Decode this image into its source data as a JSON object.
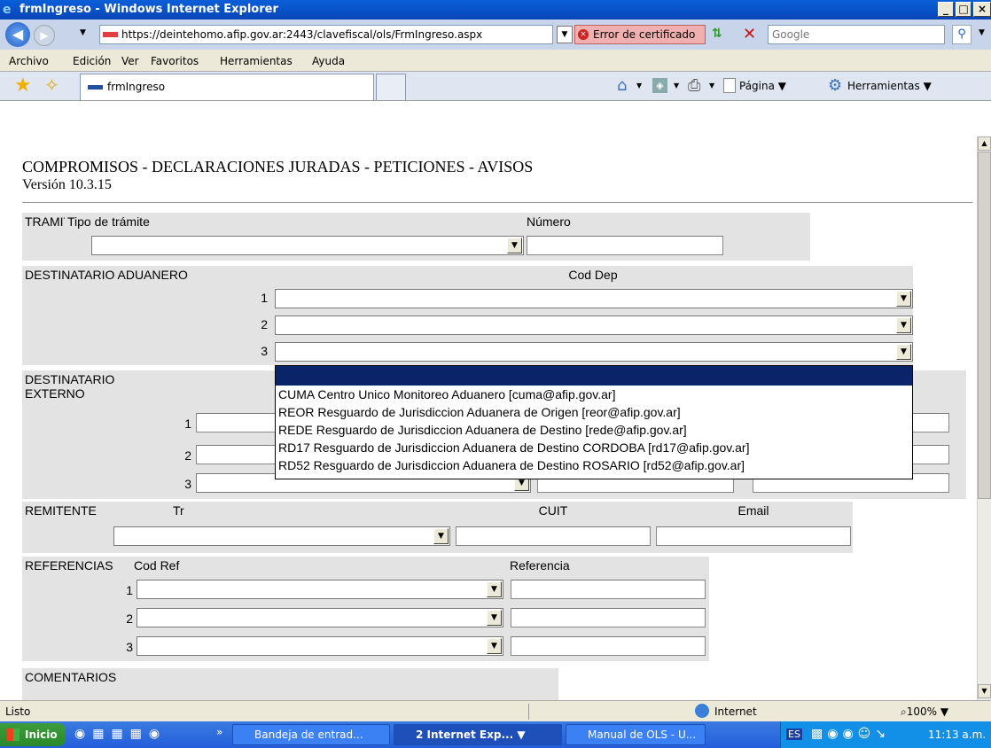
{
  "window": {
    "title": "frmIngreso - Windows Internet Explorer",
    "min": "_",
    "max": "□",
    "close": "×"
  },
  "address": {
    "url": "https://deintehomo.afip.gov.ar:2443/clavefiscal/ols/FrmIngreso.aspx",
    "cert_error": "Error de certificado",
    "search_placeholder": "Google"
  },
  "menu": [
    "Archivo",
    "Edición",
    "Ver",
    "Favoritos",
    "Herramientas",
    "Ayuda"
  ],
  "tab": {
    "label": "frmIngreso"
  },
  "cmdbar": {
    "pagina": "Página",
    "herramientas": "Herramientas"
  },
  "page": {
    "title": "COMPROMISOS - DECLARACIONES JURADAS - PETICIONES - AVISOS",
    "version": "Versión 10.3.15"
  },
  "tramite": {
    "label": "TRAMITE",
    "tipo": "Tipo de trámite",
    "numero": "Número"
  },
  "dest_aduanero": {
    "label": "DESTINATARIO ADUANERO",
    "col": "Cod Dep",
    "rows": [
      "1",
      "2",
      "3"
    ]
  },
  "dest_externo": {
    "label1": "DESTINATARIO",
    "label2": "EXTERNO",
    "rows": [
      "1",
      "2",
      "3"
    ]
  },
  "dropdown": {
    "options": [
      "",
      "CUMA Centro Unico Monitoreo Aduanero [cuma@afip.gov.ar]",
      "REOR Resguardo de Jurisdiccion Aduanera de Origen [reor@afip.gov.ar]",
      "REDE Resguardo de Jurisdiccion Aduanera de Destino [rede@afip.gov.ar]",
      "RD17 Resguardo de Jurisdiccion Aduanera de Destino CORDOBA [rd17@afip.gov.ar]",
      "RD52 Resguardo de Jurisdiccion Aduanera de Destino ROSARIO [rd52@afip.gov.ar]"
    ]
  },
  "remitente": {
    "label": "REMITENTE",
    "tr": "Tr",
    "cuit": "CUIT",
    "email": "Email"
  },
  "referencias": {
    "label": "REFERENCIAS",
    "codref": "Cod Ref",
    "referencia": "Referencia",
    "rows": [
      "1",
      "2",
      "3"
    ]
  },
  "comentarios": {
    "label": "COMENTARIOS"
  },
  "status": {
    "text": "Listo",
    "zone": "Internet",
    "zoom": "100%"
  },
  "taskbar": {
    "start": "Inicio",
    "items": [
      "Bandeja de entrad...",
      "2 Internet Exp...",
      "Manual de OLS - U..."
    ],
    "lang": "ES",
    "clock": "11:13 a.m."
  }
}
